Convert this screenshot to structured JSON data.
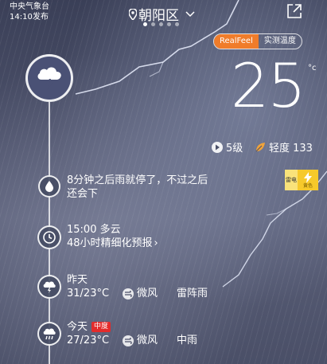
{
  "header": {
    "source_line1": "中央气象台",
    "source_line2": "14:10发布",
    "location": "朝阳区"
  },
  "toggle": {
    "realfeel": "RealFeel",
    "actual": "实测温度"
  },
  "current": {
    "temp": "25",
    "unit": "°c",
    "wind": "5级",
    "air_quality": "轻度 133"
  },
  "alert_badge": {
    "label": "雷电",
    "level": "黄色"
  },
  "timeline": {
    "nowcast": {
      "line1": "8分钟之后雨就停了，不过之后",
      "line2": "还会下"
    },
    "hourly": {
      "line1": "15:00 多云",
      "line2": "48小时精细化预报",
      "chevron": "›"
    },
    "yesterday": {
      "label": "昨天",
      "temps": "31/23°C",
      "wind": "微风",
      "weather": "雷阵雨"
    },
    "today": {
      "label": "今天",
      "tag": "中度",
      "temps": "27/23°C",
      "wind": "微风",
      "weather": "中雨"
    }
  },
  "colors": {
    "accent": "#f07c2a",
    "warning_yellow": "#f6c92b",
    "tag_red": "#e32b2b"
  }
}
